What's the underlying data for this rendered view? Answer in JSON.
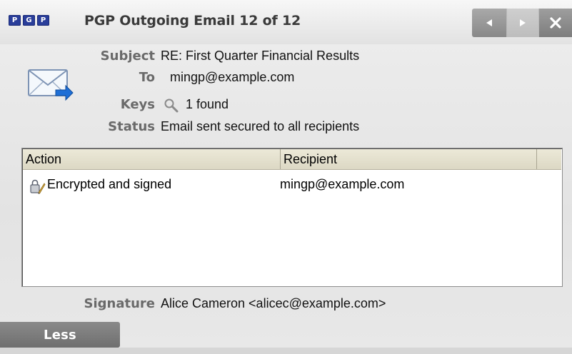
{
  "titlebar": {
    "logo_letters": [
      "P",
      "G",
      "P"
    ],
    "title": "PGP Outgoing Email 12 of 12",
    "icons": {
      "prev": "left-arrow-icon",
      "next": "right-arrow-icon",
      "close": "close-icon"
    }
  },
  "header": {
    "icon": "envelope-send-icon",
    "subject_label": "Subject",
    "subject": "RE: First Quarter Financial Results",
    "to_label": "To",
    "to": "mingp@example.com",
    "keys_label": "Keys",
    "keys_icon": "magnifier-icon",
    "keys": "1 found",
    "status_label": "Status",
    "status": "Email sent secured to all recipients"
  },
  "table": {
    "columns": [
      "Action",
      "Recipient"
    ],
    "rows": [
      {
        "icon": "lock-sign-icon",
        "action": "Encrypted and signed",
        "recipient": "mingp@example.com"
      }
    ]
  },
  "signature": {
    "label": "Signature",
    "value": "Alice Cameron <alicec@example.com>"
  },
  "footer": {
    "less_label": "Less"
  },
  "colors": {
    "logo": "#2a3e9a",
    "title_text": "#3a3a3a",
    "label_text": "#6a6a6a",
    "table_header": "#ece9d8"
  }
}
